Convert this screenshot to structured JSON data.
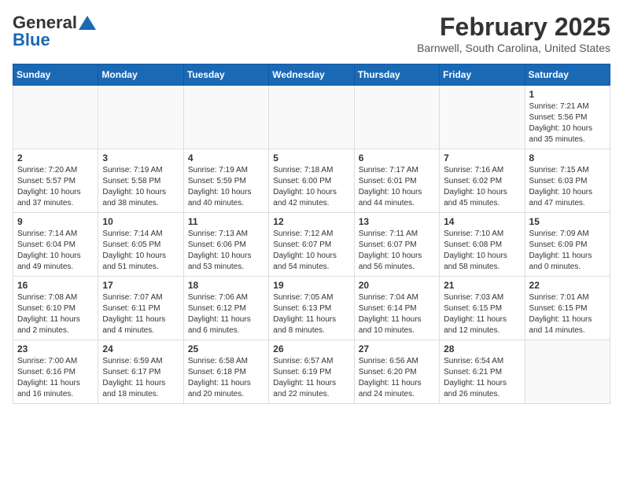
{
  "header": {
    "logo_general": "General",
    "logo_blue": "Blue",
    "month_title": "February 2025",
    "location": "Barnwell, South Carolina, United States"
  },
  "calendar": {
    "days_of_week": [
      "Sunday",
      "Monday",
      "Tuesday",
      "Wednesday",
      "Thursday",
      "Friday",
      "Saturday"
    ],
    "weeks": [
      [
        {
          "day": "",
          "info": ""
        },
        {
          "day": "",
          "info": ""
        },
        {
          "day": "",
          "info": ""
        },
        {
          "day": "",
          "info": ""
        },
        {
          "day": "",
          "info": ""
        },
        {
          "day": "",
          "info": ""
        },
        {
          "day": "1",
          "info": "Sunrise: 7:21 AM\nSunset: 5:56 PM\nDaylight: 10 hours and 35 minutes."
        }
      ],
      [
        {
          "day": "2",
          "info": "Sunrise: 7:20 AM\nSunset: 5:57 PM\nDaylight: 10 hours and 37 minutes."
        },
        {
          "day": "3",
          "info": "Sunrise: 7:19 AM\nSunset: 5:58 PM\nDaylight: 10 hours and 38 minutes."
        },
        {
          "day": "4",
          "info": "Sunrise: 7:19 AM\nSunset: 5:59 PM\nDaylight: 10 hours and 40 minutes."
        },
        {
          "day": "5",
          "info": "Sunrise: 7:18 AM\nSunset: 6:00 PM\nDaylight: 10 hours and 42 minutes."
        },
        {
          "day": "6",
          "info": "Sunrise: 7:17 AM\nSunset: 6:01 PM\nDaylight: 10 hours and 44 minutes."
        },
        {
          "day": "7",
          "info": "Sunrise: 7:16 AM\nSunset: 6:02 PM\nDaylight: 10 hours and 45 minutes."
        },
        {
          "day": "8",
          "info": "Sunrise: 7:15 AM\nSunset: 6:03 PM\nDaylight: 10 hours and 47 minutes."
        }
      ],
      [
        {
          "day": "9",
          "info": "Sunrise: 7:14 AM\nSunset: 6:04 PM\nDaylight: 10 hours and 49 minutes."
        },
        {
          "day": "10",
          "info": "Sunrise: 7:14 AM\nSunset: 6:05 PM\nDaylight: 10 hours and 51 minutes."
        },
        {
          "day": "11",
          "info": "Sunrise: 7:13 AM\nSunset: 6:06 PM\nDaylight: 10 hours and 53 minutes."
        },
        {
          "day": "12",
          "info": "Sunrise: 7:12 AM\nSunset: 6:07 PM\nDaylight: 10 hours and 54 minutes."
        },
        {
          "day": "13",
          "info": "Sunrise: 7:11 AM\nSunset: 6:07 PM\nDaylight: 10 hours and 56 minutes."
        },
        {
          "day": "14",
          "info": "Sunrise: 7:10 AM\nSunset: 6:08 PM\nDaylight: 10 hours and 58 minutes."
        },
        {
          "day": "15",
          "info": "Sunrise: 7:09 AM\nSunset: 6:09 PM\nDaylight: 11 hours and 0 minutes."
        }
      ],
      [
        {
          "day": "16",
          "info": "Sunrise: 7:08 AM\nSunset: 6:10 PM\nDaylight: 11 hours and 2 minutes."
        },
        {
          "day": "17",
          "info": "Sunrise: 7:07 AM\nSunset: 6:11 PM\nDaylight: 11 hours and 4 minutes."
        },
        {
          "day": "18",
          "info": "Sunrise: 7:06 AM\nSunset: 6:12 PM\nDaylight: 11 hours and 6 minutes."
        },
        {
          "day": "19",
          "info": "Sunrise: 7:05 AM\nSunset: 6:13 PM\nDaylight: 11 hours and 8 minutes."
        },
        {
          "day": "20",
          "info": "Sunrise: 7:04 AM\nSunset: 6:14 PM\nDaylight: 11 hours and 10 minutes."
        },
        {
          "day": "21",
          "info": "Sunrise: 7:03 AM\nSunset: 6:15 PM\nDaylight: 11 hours and 12 minutes."
        },
        {
          "day": "22",
          "info": "Sunrise: 7:01 AM\nSunset: 6:15 PM\nDaylight: 11 hours and 14 minutes."
        }
      ],
      [
        {
          "day": "23",
          "info": "Sunrise: 7:00 AM\nSunset: 6:16 PM\nDaylight: 11 hours and 16 minutes."
        },
        {
          "day": "24",
          "info": "Sunrise: 6:59 AM\nSunset: 6:17 PM\nDaylight: 11 hours and 18 minutes."
        },
        {
          "day": "25",
          "info": "Sunrise: 6:58 AM\nSunset: 6:18 PM\nDaylight: 11 hours and 20 minutes."
        },
        {
          "day": "26",
          "info": "Sunrise: 6:57 AM\nSunset: 6:19 PM\nDaylight: 11 hours and 22 minutes."
        },
        {
          "day": "27",
          "info": "Sunrise: 6:56 AM\nSunset: 6:20 PM\nDaylight: 11 hours and 24 minutes."
        },
        {
          "day": "28",
          "info": "Sunrise: 6:54 AM\nSunset: 6:21 PM\nDaylight: 11 hours and 26 minutes."
        },
        {
          "day": "",
          "info": ""
        }
      ]
    ]
  }
}
